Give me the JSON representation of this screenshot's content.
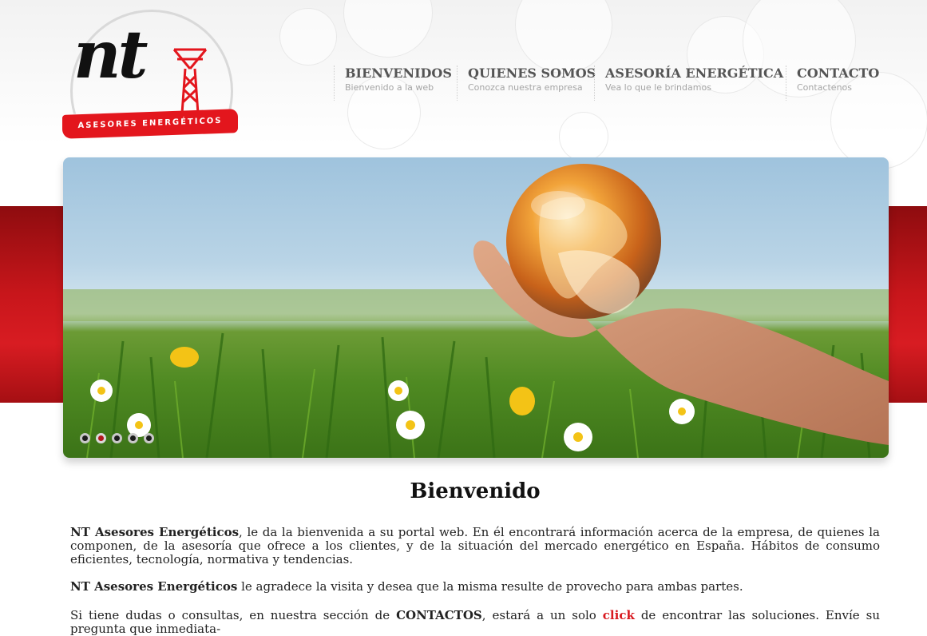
{
  "logo": {
    "brand": "nt",
    "tagline": "ASESORES ENERGÉTICOS"
  },
  "nav": [
    {
      "title": "BIENVENIDOS",
      "subtitle": "Bienvenido a la web"
    },
    {
      "title": "QUIENES SOMOS",
      "subtitle": "Conozca nuestra empresa"
    },
    {
      "title": "ASESORÍA ENERGÉTICA",
      "subtitle": "Vea lo que le brindamos"
    },
    {
      "title": "CONTACTO",
      "subtitle": "Contactenos"
    }
  ],
  "slider": {
    "slide_count": 5,
    "active_slide": 2
  },
  "colors": {
    "brand_red": "#d81c22",
    "link_red": "#d8181e"
  },
  "content": {
    "heading": "Bienvenido",
    "p1_company": "NT Asesores Energéticos",
    "p1_text": ", le da la bienvenida a su portal web. En él encontrará información acerca de la empresa, de quienes la componen, de la asesoría que ofrece a los clientes, y de la situación del mercado energético en España. Hábitos de consumo eficientes, tecnología, normativa y tendencias.",
    "p2_company": "NT Asesores Energéticos",
    "p2_text": " le agradece la visita y desea que la misma resulte de provecho para ambas partes.",
    "p3_start": "Si tiene dudas o consultas, en nuestra sección de ",
    "p3_contacts": "CONTACTOS",
    "p3_mid": ", estará a un solo ",
    "p3_click": "click",
    "p3_end": " de encontrar las soluciones. Envíe su pregunta que inmediata-"
  }
}
